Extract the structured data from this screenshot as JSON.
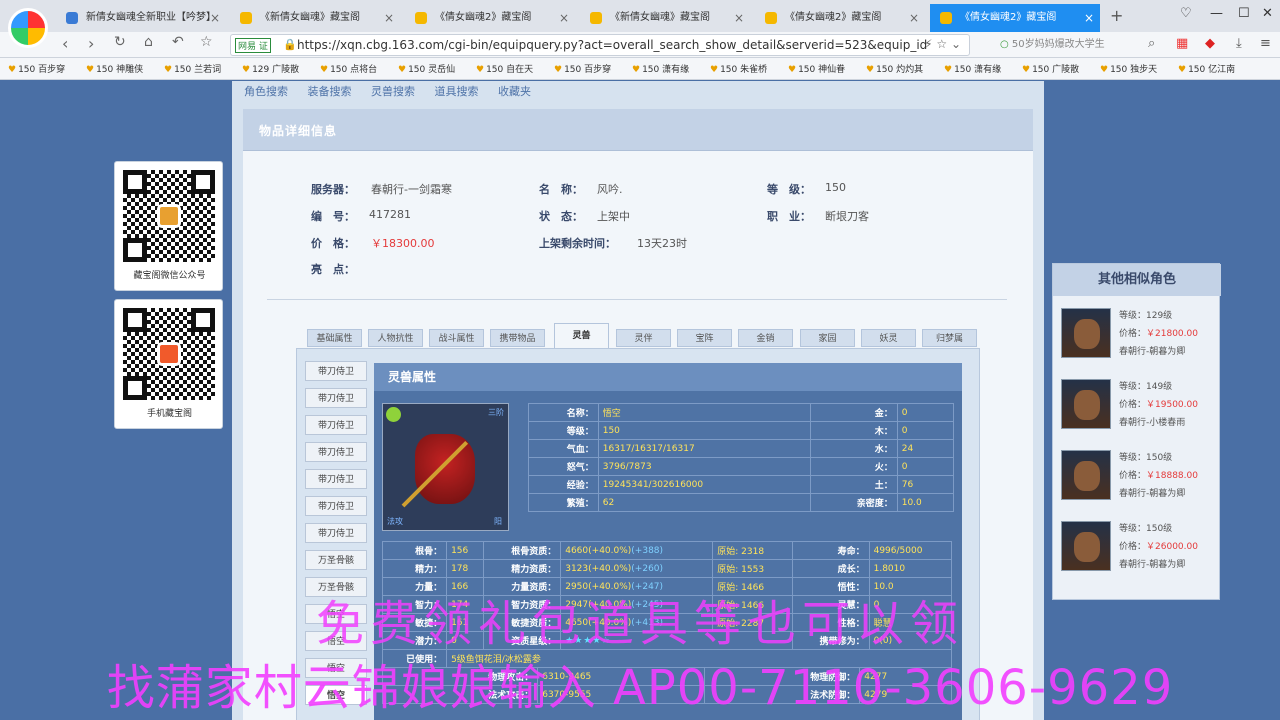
{
  "browser": {
    "tabs": [
      {
        "title": "新倩女幽魂全新职业【吟梦】"
      },
      {
        "title": "《新倩女幽魂》藏宝阁"
      },
      {
        "title": "《倩女幽魂2》藏宝阁"
      },
      {
        "title": "《新倩女幽魂》藏宝阁"
      },
      {
        "title": "《倩女幽魂2》藏宝阁"
      },
      {
        "title": "《倩女幽魂2》藏宝阁"
      }
    ],
    "url_badge": "网易 证",
    "url": "https://xqn.cbg.163.com/cgi-bin/equipquery.py?act=overall_search_show_detail&serverid=523&equip_id",
    "search_placeholder": "50岁妈妈爆改大学生",
    "bookmarks": [
      "150 百步穿",
      "150 神雕侠",
      "150 兰若词",
      "129 广陵散",
      "150 点将台",
      "150 灵岳仙",
      "150 自在天",
      "150 百步穿",
      "150 潇有缘",
      "150 朱雀桥",
      "150 神仙眷",
      "150 灼灼其",
      "150 潇有缘",
      "150 广陵散",
      "150 独步天",
      "150 亿江南"
    ]
  },
  "topnav": [
    "角色搜索",
    "装备搜索",
    "灵兽搜索",
    "道具搜索",
    "收藏夹"
  ],
  "section_title": "物品详细信息",
  "info": {
    "server_label": "服务器：",
    "server": "春朝行-一剑霜寒",
    "name_label": "名　称：",
    "name": "风吟.",
    "level_label": "等　级：",
    "level": "150",
    "id_label": "编　号：",
    "id": "417281",
    "status_label": "状　态：",
    "status": "上架中",
    "job_label": "职　业：",
    "job": "断垠刀客",
    "price_label": "价　格：",
    "price": "￥18300.00",
    "remain_label": "上架剩余时间：",
    "remain": "13天23时",
    "highlight_label": "亮　点："
  },
  "tabs": [
    "基础属性",
    "人物抗性",
    "战斗属性",
    "携带物品",
    "灵兽",
    "灵伴",
    "宝阵",
    "金销",
    "家园",
    "妖灵",
    "归梦属"
  ],
  "side_items": [
    "带刀侍卫",
    "带刀侍卫",
    "带刀侍卫",
    "带刀侍卫",
    "带刀侍卫",
    "带刀侍卫",
    "带刀侍卫",
    "万圣骨骸",
    "万圣骨骸",
    "悟空",
    "悟空",
    "悟空",
    "悟空"
  ],
  "detail_title": "灵兽属性",
  "pet_img": {
    "stage": "三阶",
    "type": "法攻",
    "tag": "阳"
  },
  "pet_basic": [
    [
      "名称：",
      "悟空",
      "金：",
      "0"
    ],
    [
      "等级：",
      "150",
      "木：",
      "0"
    ],
    [
      "气血：",
      "16317/16317/16317",
      "水：",
      "24"
    ],
    [
      "怒气：",
      "3796/7873",
      "火：",
      "0"
    ],
    [
      "经验：",
      "19245341/302616000",
      "土：",
      "76"
    ],
    [
      "繁殖：",
      "62",
      "亲密度：",
      "10.0"
    ]
  ],
  "pet_stats": [
    [
      "根骨：",
      "156",
      "根骨资质：",
      "4660(+40.0%)",
      "(+388)",
      "原始: 2318",
      "寿命：",
      "4996/5000"
    ],
    [
      "精力：",
      "178",
      "精力资质：",
      "3123(+40.0%)",
      "(+260)",
      "原始: 1553",
      "成长：",
      "1.8010"
    ],
    [
      "力量：",
      "166",
      "力量资质：",
      "2950(+40.0%)",
      "(+247)",
      "原始: 1466",
      "悟性：",
      "10.0"
    ],
    [
      "智力：",
      "174",
      "智力资质：",
      "2947(+40.0%)",
      "(+245)",
      "原始: 1466",
      "灵慧：",
      "0"
    ],
    [
      "敏捷：",
      "161",
      "敏捷资质：",
      "4650(+40.0%)",
      "(+413)",
      "原始: 2287",
      "性格：",
      "聪慧"
    ]
  ],
  "pet_extra": {
    "potential_label": "潜力：",
    "potential": "0",
    "stars_label": "资质星级：",
    "stars": "★★★★☆",
    "carry_label": "携带修为：",
    "carry": "0(0)",
    "used_label": "已使用：",
    "used": "5级鱼饵花泪/冰松露参"
  },
  "pet_combat": [
    [
      "物理攻击：",
      "6310-9465",
      "物理防御：",
      "4277"
    ],
    [
      "法术攻击：",
      "6370-9555",
      "法术防御：",
      "4279"
    ]
  ],
  "qr": [
    {
      "caption": "藏宝阁微信公众号"
    },
    {
      "caption": "手机藏宝阁"
    }
  ],
  "similar_title": "其他相似角色",
  "similar": [
    {
      "level": "等级：129级",
      "price_label": "价格：",
      "price": "￥21800.00",
      "server": "春朝行-朝暮为卿"
    },
    {
      "level": "等级：149级",
      "price_label": "价格：",
      "price": "￥19500.00",
      "server": "春朝行-小楼春雨"
    },
    {
      "level": "等级：150级",
      "price_label": "价格：",
      "price": "￥18888.00",
      "server": "春朝行-朝暮为卿"
    },
    {
      "level": "等级：150级",
      "price_label": "价格：",
      "price": "￥26000.00",
      "server": "春朝行-朝暮为卿"
    }
  ],
  "watermark": {
    "line1": "免费领礼包道具等也可以领",
    "line2": "找蒲家村云锦娘娘输入 AP00-7110-3606-9629"
  }
}
